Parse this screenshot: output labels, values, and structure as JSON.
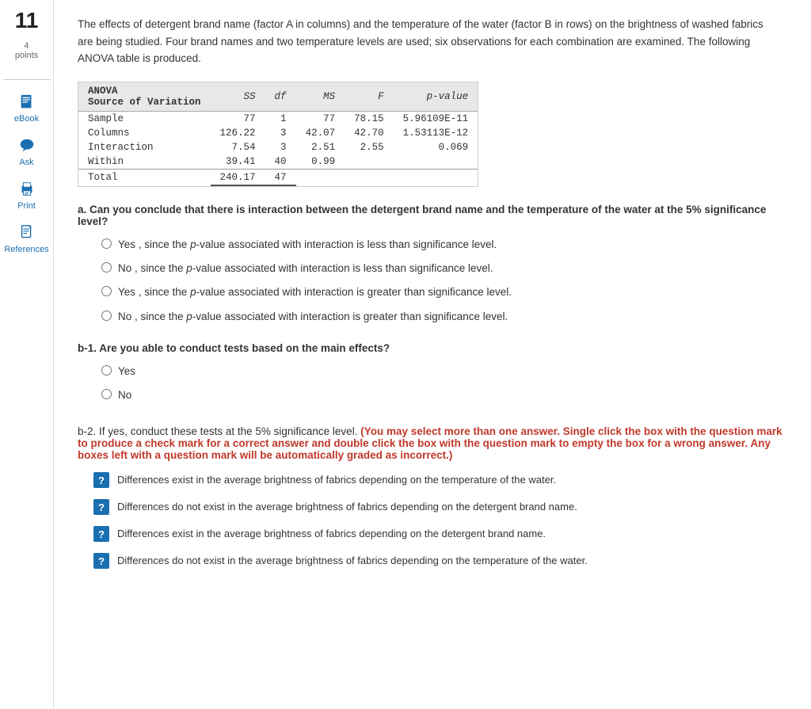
{
  "sidebar": {
    "question_number": "11",
    "points_label": "4\npoints",
    "items": [
      {
        "id": "ebook",
        "label": "eBook",
        "icon": "book"
      },
      {
        "id": "ask",
        "label": "Ask",
        "icon": "chat"
      },
      {
        "id": "print",
        "label": "Print",
        "icon": "print"
      },
      {
        "id": "references",
        "label": "References",
        "icon": "document"
      }
    ]
  },
  "intro": "The effects of detergent brand name (factor A in columns) and the temperature of the water (factor B in rows) on the brightness of washed fabrics are being studied. Four brand names and two temperature levels are used; six observations for each combination are examined. The following ANOVA table is produced.",
  "anova_table": {
    "headers": [
      "ANOVA\nSource of Variation",
      "SS",
      "df",
      "MS",
      "F",
      "p-value"
    ],
    "rows": [
      {
        "source": "Sample",
        "ss": "77",
        "df": "1",
        "ms": "77",
        "f": "78.15",
        "pvalue": "5.96109E-11"
      },
      {
        "source": "Columns",
        "ss": "126.22",
        "df": "3",
        "ms": "42.07",
        "f": "42.70",
        "pvalue": "1.53113E-12"
      },
      {
        "source": "Interaction",
        "ss": "7.54",
        "df": "3",
        "ms": "2.51",
        "f": "2.55",
        "pvalue": "0.069"
      },
      {
        "source": "Within",
        "ss": "39.41",
        "df": "40",
        "ms": "0.99",
        "f": "",
        "pvalue": ""
      },
      {
        "source": "Total",
        "ss": "240.17",
        "df": "47",
        "ms": "",
        "f": "",
        "pvalue": "",
        "is_total": true
      }
    ]
  },
  "part_a": {
    "label": "a.",
    "question": "Can you conclude that there is interaction between the detergent brand name and the temperature of the water at the 5% significance level?",
    "options": [
      {
        "id": "a1",
        "text_before": "Yes , since the ",
        "italic": "p-value",
        "text_after": " associated with interaction is less than significance level."
      },
      {
        "id": "a2",
        "text_before": "No , since the ",
        "italic": "p-value",
        "text_after": " associated with interaction is less than significance level."
      },
      {
        "id": "a3",
        "text_before": "Yes , since the ",
        "italic": "p-value",
        "text_after": " associated with interaction is greater than significance level."
      },
      {
        "id": "a4",
        "text_before": "No , since the ",
        "italic": "p-value",
        "text_after": " associated with interaction is greater than significance level."
      }
    ]
  },
  "part_b1": {
    "label": "b-1.",
    "question": "Are you able to conduct tests based on the main effects?",
    "options": [
      {
        "id": "b1_yes",
        "text": "Yes"
      },
      {
        "id": "b1_no",
        "text": "No"
      }
    ]
  },
  "part_b2": {
    "label": "b-2.",
    "question_normal": "If yes, conduct these tests at the 5% significance level.",
    "question_bold_red": "(You may select more than one answer. Single click the box with the question mark to produce a check mark for a correct answer and double click the box with the question mark to empty the box for a wrong answer. Any boxes left with a question mark will be automatically graded as incorrect.)",
    "options": [
      {
        "id": "cb1",
        "text": "Differences exist in the average brightness of fabrics depending on the temperature of the water."
      },
      {
        "id": "cb2",
        "text": "Differences do not exist in the average brightness of fabrics depending on the detergent brand name."
      },
      {
        "id": "cb3",
        "text": "Differences exist in the average brightness of fabrics depending on the detergent brand name."
      },
      {
        "id": "cb4",
        "text": "Differences do not exist in the average brightness of fabrics depending on the temperature of the water."
      }
    ],
    "question_mark": "?"
  }
}
